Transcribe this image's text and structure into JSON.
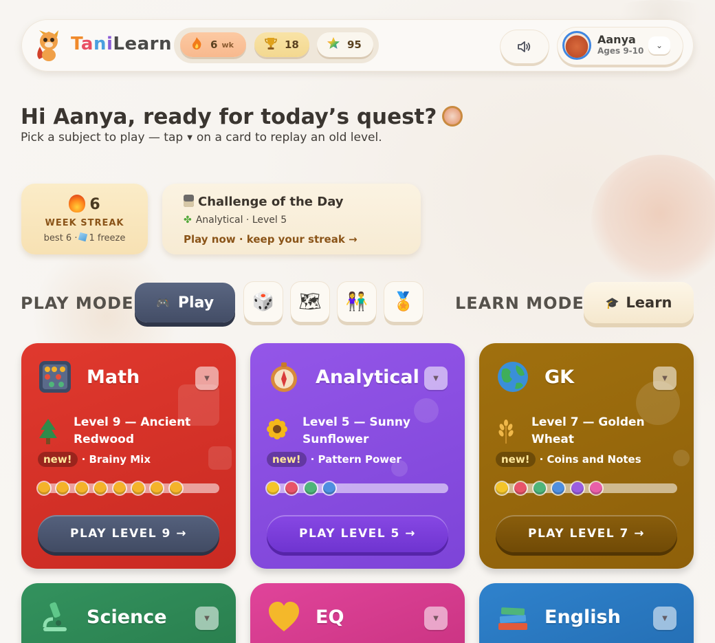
{
  "brand": {
    "name_parts": [
      "T",
      "a",
      "n",
      "i",
      "Learn"
    ]
  },
  "stats": {
    "streak_value": "6",
    "streak_unit": "wk",
    "trophies": "18",
    "stars": "95"
  },
  "profile": {
    "name": "Aanya",
    "age": "Ages 9-10"
  },
  "greeting": {
    "title": "Hi Aanya, ready for today’s quest?",
    "sub_before": "Pick a subject to play — tap",
    "sub_after": "on a card to replay an old level."
  },
  "streak_card": {
    "count": "6",
    "label": "WEEK STREAK",
    "best": "best 6 ·",
    "freeze": "1 freeze"
  },
  "challenge": {
    "title": "Challenge of the Day",
    "subtitle": "Analytical · Level 5",
    "cta": "Play now · keep your streak →"
  },
  "modes": {
    "play_label": "PLAY MODE",
    "play_button": "Play",
    "learn_label": "LEARN MODE",
    "learn_button": "Learn",
    "extra_icons": [
      "dice-icon",
      "map-icon",
      "friends-icon",
      "medals-icon"
    ]
  },
  "subjects": [
    {
      "name": "Math",
      "level_title": "Level 9 — Ancient Redwood",
      "tag": "new!",
      "topic": "· Brainy Mix",
      "cta": "PLAY LEVEL 9 →",
      "color": "#d9302a",
      "dots_done": 8,
      "dot_colors": [
        "#f4b32a",
        "#f4b32a",
        "#f4b32a",
        "#f4b32a",
        "#f4b32a",
        "#f4b32a",
        "#f4b32a",
        "#f4b32a"
      ],
      "cta_color": "#485470"
    },
    {
      "name": "Analytical",
      "level_title": "Level 5 — Sunny Sunflower",
      "tag": "new!",
      "topic": "· Pattern Power",
      "cta": "PLAY LEVEL 5 →",
      "color": "#8a4ee0",
      "dots_done": 4,
      "dot_colors": [
        "#f4c52a",
        "#e8546a",
        "#4fb57a",
        "#4f8fe0"
      ],
      "cta_color": "#7a3ed6"
    },
    {
      "name": "GK",
      "level_title": "Level 7 — Golden Wheat",
      "tag": "new!",
      "topic": "· Coins and Notes",
      "cta": "PLAY LEVEL 7 →",
      "color": "#9a6a0c",
      "dots_done": 6,
      "dot_colors": [
        "#f4c52a",
        "#e8546a",
        "#4fb57a",
        "#4f8fe0",
        "#9b5ee0",
        "#e85fa8"
      ],
      "cta_color": "#7e5408"
    },
    {
      "name": "Science",
      "color": "#2e8a58"
    },
    {
      "name": "EQ",
      "color": "#d83a8a"
    },
    {
      "name": "English",
      "color": "#2a78c0"
    }
  ]
}
